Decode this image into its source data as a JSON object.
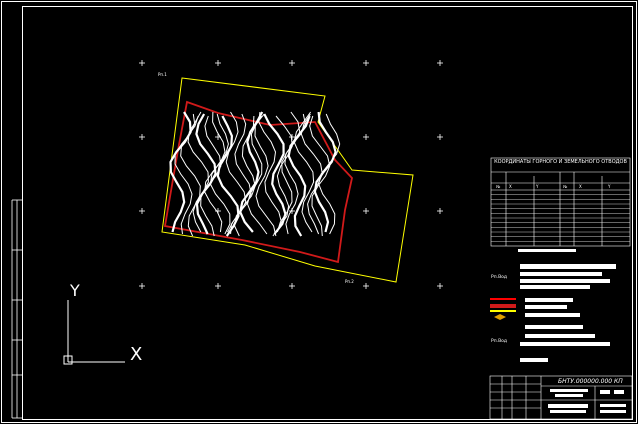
{
  "drawing": {
    "title": "КООРДИНАТЫ ГОРНОГО И ЗЕМЕЛЬНОГО ОТВОДОВ",
    "stamp_code": "БНТУ.000000.000 КП",
    "label_pt1": "Рп.1",
    "label_pt2": "Рп.2",
    "legend_b1": "Рп.Вод",
    "legend_b2": "Рп.Вод",
    "ucs": {
      "x_label": "X",
      "y_label": "Y"
    }
  },
  "colors": {
    "background": "#000000",
    "frame": "#ffffff",
    "boundary_yellow": "#ffff00",
    "boundary_red": "#d11a1a",
    "contour": "#ffffff"
  },
  "coords_table": {
    "columns": [
      "№",
      "X",
      "Y",
      "№",
      "X",
      "Y"
    ],
    "rows": 12
  }
}
